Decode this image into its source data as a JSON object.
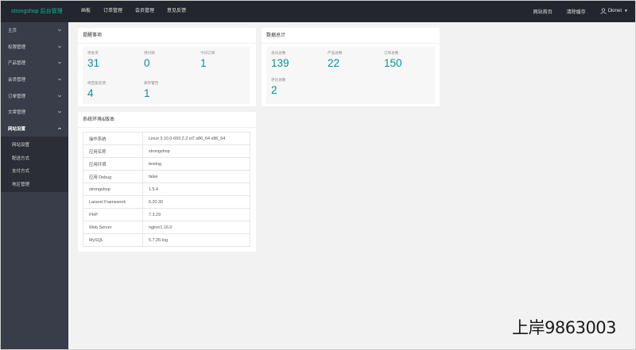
{
  "brand": "strongshop 后台管理",
  "top_nav": [
    "画板",
    "订单管理",
    "会员管理",
    "意见反馈"
  ],
  "top_right": {
    "home": "网站首页",
    "clear_cache": "清除缓存",
    "user": "Dkmet"
  },
  "sidebar": {
    "items": [
      {
        "label": "主页"
      },
      {
        "label": "权限管理"
      },
      {
        "label": "产品管理"
      },
      {
        "label": "会员管理"
      },
      {
        "label": "订单管理"
      },
      {
        "label": "文章管理"
      },
      {
        "label": "网站设置"
      }
    ],
    "sub_items": [
      "网站设置",
      "配送方式",
      "支付方式",
      "地区管理"
    ]
  },
  "reminders": {
    "title": "提醒事项",
    "items": [
      {
        "label": "待发货",
        "value": "31"
      },
      {
        "label": "待付款",
        "value": "0"
      },
      {
        "label": "今日订单",
        "value": "1"
      },
      {
        "label": "待回复反馈",
        "value": "4"
      },
      {
        "label": "库存警告",
        "value": "1"
      }
    ]
  },
  "totals": {
    "title": "数据总计",
    "items": [
      {
        "label": "会员总数",
        "value": "139"
      },
      {
        "label": "产品总数",
        "value": "22"
      },
      {
        "label": "订单总数",
        "value": "150"
      },
      {
        "label": "评论总数",
        "value": "2"
      }
    ]
  },
  "env": {
    "title": "系统环境&版本",
    "rows": [
      {
        "key": "操作系统",
        "value": "Linux 3.10.0-693.2.2.el7.x86_64 x86_64"
      },
      {
        "key": "应用名称",
        "value": "strongshop"
      },
      {
        "key": "应用环境",
        "value": "testing"
      },
      {
        "key": "应用 Debug",
        "value": "false"
      },
      {
        "key": "strongshop",
        "value": "1.5.4"
      },
      {
        "key": "Laravel Framework",
        "value": "6.20.30"
      },
      {
        "key": "PHP",
        "value": "7.3.29"
      },
      {
        "key": "Web Server",
        "value": "nginx/1.16.0"
      },
      {
        "key": "MySQL",
        "value": "5.7.26-log"
      }
    ]
  },
  "watermark": "上岸9863003",
  "colors": {
    "accent": "#009688",
    "topbar": "#23262e",
    "sidebar": "#393d49"
  }
}
